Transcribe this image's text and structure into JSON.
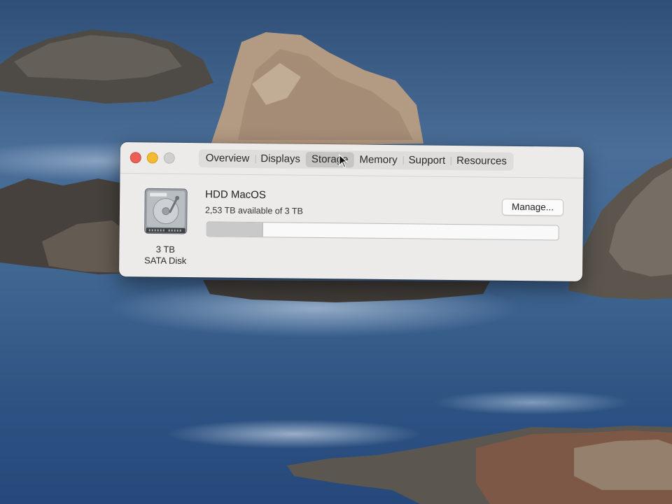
{
  "window": {
    "tabs": [
      "Overview",
      "Displays",
      "Storage",
      "Memory",
      "Support",
      "Resources"
    ],
    "active_tab": "Storage"
  },
  "disk": {
    "name": "HDD MacOS",
    "availability": "2,53 TB available of 3 TB",
    "manage_label": "Manage...",
    "capacity": "3 TB",
    "type": "SATA Disk",
    "used_fraction": 0.157
  },
  "colors": {
    "close": "#ec5f57",
    "minimize": "#f3bb2f",
    "zoom_disabled": "#cfcfcf",
    "window_bg": "#ecebea"
  }
}
